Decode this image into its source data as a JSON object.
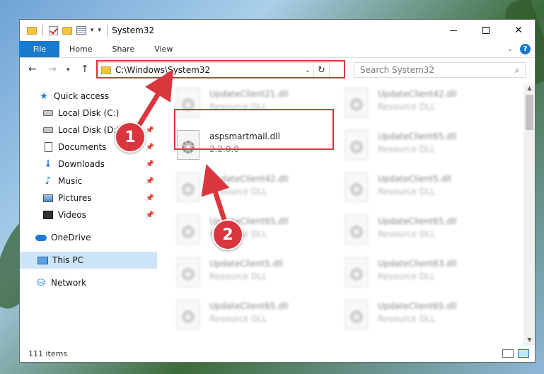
{
  "window": {
    "title": "System32"
  },
  "ribbon": {
    "tabs": [
      "File",
      "Home",
      "Share",
      "View"
    ],
    "help": "?"
  },
  "address": {
    "path": "C:\\Windows\\System32"
  },
  "search": {
    "placeholder": "Search System32"
  },
  "sidebar": {
    "items": [
      {
        "label": "Quick access",
        "icon": "star-icon"
      },
      {
        "label": "Local Disk (C:)",
        "icon": "drive-icon"
      },
      {
        "label": "Local Disk (D:)",
        "icon": "drive-icon"
      },
      {
        "label": "Documents",
        "icon": "documents-icon"
      },
      {
        "label": "Downloads",
        "icon": "downloads-icon"
      },
      {
        "label": "Music",
        "icon": "music-icon"
      },
      {
        "label": "Pictures",
        "icon": "pictures-icon"
      },
      {
        "label": "Videos",
        "icon": "videos-icon"
      },
      {
        "label": "OneDrive",
        "icon": "onedrive-icon"
      },
      {
        "label": "This PC",
        "icon": "this-pc-icon"
      },
      {
        "label": "Network",
        "icon": "network-icon"
      }
    ]
  },
  "files": {
    "highlighted": {
      "name": "aspsmartmail.dll",
      "version": "2.2.0.0"
    },
    "blurred": [
      {
        "name": "UpdateClient21.dll",
        "type": "Resource DLL"
      },
      {
        "name": "UpdateClient42.dll",
        "type": "Resource DLL"
      },
      {
        "name": "UpdateClient65.dll",
        "type": "Resource DLL"
      },
      {
        "name": "UpdateClient42.dll",
        "type": "Resource DLL"
      },
      {
        "name": "UpdateClient5.dll",
        "type": "Resource DLL"
      },
      {
        "name": "UpdateClient65.dll",
        "type": "Resource DLL"
      },
      {
        "name": "UpdateClient65.dll",
        "type": "Resource DLL"
      },
      {
        "name": "UpdateClient5.dll",
        "type": "Resource DLL"
      },
      {
        "name": "UpdateClient63.dll",
        "type": "Resource DLL"
      },
      {
        "name": "UpdateClient65.dll",
        "type": "Resource DLL"
      },
      {
        "name": "UpdateClient65.dll",
        "type": "Resource DLL"
      }
    ]
  },
  "status": {
    "count": "111 items"
  },
  "annotations": {
    "step1": "1",
    "step2": "2"
  },
  "colors": {
    "accent": "#1979ca",
    "highlight": "#d9363e",
    "selected": "#cce4f7"
  }
}
